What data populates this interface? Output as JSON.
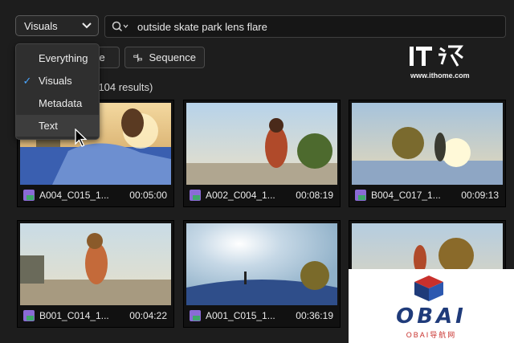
{
  "search_mode": {
    "selected": "Visuals"
  },
  "search": {
    "query": "outside skate park lens flare"
  },
  "filters": [
    {
      "label": "ce"
    },
    {
      "label": "Sequence"
    }
  ],
  "results_text": "of 104 results)",
  "dropdown": {
    "items": [
      {
        "label": "Everything",
        "checked": false
      },
      {
        "label": "Visuals",
        "checked": true
      },
      {
        "label": "Metadata",
        "checked": false
      },
      {
        "label": "Text",
        "checked": false
      }
    ]
  },
  "clips": [
    {
      "name": "A004_C015_1...",
      "duration": "00:05:00"
    },
    {
      "name": "A002_C004_1...",
      "duration": "00:08:19"
    },
    {
      "name": "B004_C017_1...",
      "duration": "00:09:13"
    },
    {
      "name": "B001_C014_1...",
      "duration": "00:04:22"
    },
    {
      "name": "A001_C015_1...",
      "duration": "00:36:19"
    },
    {
      "name": "",
      "duration": ""
    }
  ],
  "watermark": {
    "site": "www.ithome.com",
    "brand": "OBAI",
    "brand_sub": "OBAI导航网"
  },
  "colors": {
    "background": "#1d1d1d",
    "accent_check": "#4aa6ff",
    "clip_icon": "#8a6bd6"
  }
}
